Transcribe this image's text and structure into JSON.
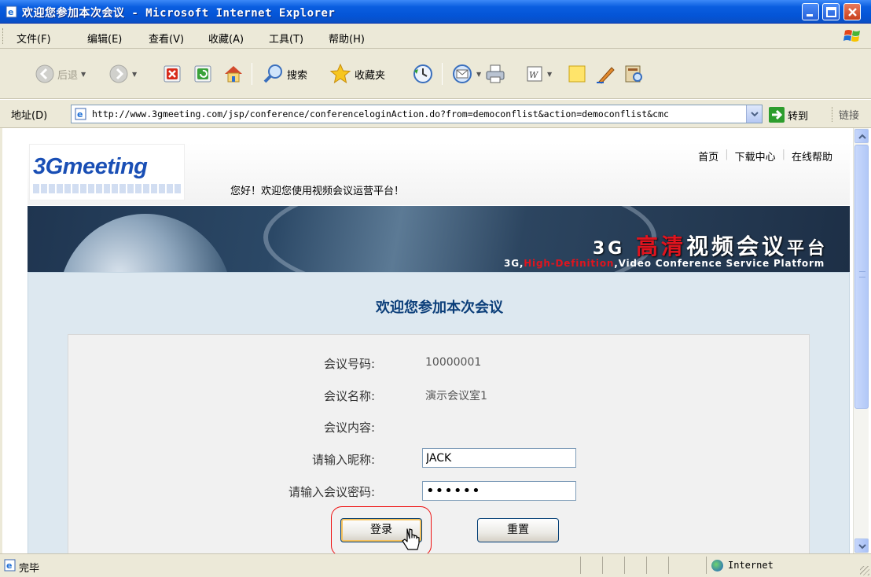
{
  "window": {
    "title": "欢迎您参加本次会议 - Microsoft Internet Explorer"
  },
  "menu": [
    "文件(F)",
    "编辑(E)",
    "查看(V)",
    "收藏(A)",
    "工具(T)",
    "帮助(H)"
  ],
  "toolbar": {
    "back": "后退",
    "search": "搜索",
    "favorites": "收藏夹"
  },
  "address": {
    "label": "地址(D)",
    "url": "http://www.3gmeeting.com/jsp/conference/conferenceloginAction.do?from=democonflist&action=democonflist&cmc",
    "go": "转到",
    "links": "链接"
  },
  "header": {
    "logo": "3Gmeeting",
    "welcome": "您好！欢迎您使用视频会议运营平台！",
    "nav": [
      "首页",
      "下载中心",
      "在线帮助"
    ]
  },
  "banner": {
    "title_prefix": "3G",
    "title_highlight": "高清",
    "title_main": "视频会议",
    "title_suffix": "平台",
    "subtitle_prefix": "3G,",
    "subtitle_highlight": "High-Definition",
    "subtitle_rest": ",Video Conference Service Platform"
  },
  "form": {
    "title": "欢迎您参加本次会议",
    "meeting_number_label": "会议号码:",
    "meeting_number": "10000001",
    "meeting_name_label": "会议名称:",
    "meeting_name": "演示会议室1",
    "meeting_content_label": "会议内容:",
    "nickname_label": "请输入昵称:",
    "nickname_value": "JACK",
    "password_label": "请输入会议密码:",
    "password_mask": "••••••",
    "login_button": "登录",
    "reset_button": "重置"
  },
  "status": {
    "text": "完毕",
    "zone": "Internet"
  },
  "colors": {
    "title_bar": "#0454d6",
    "panel_bg": "#dde8f0",
    "panel_title": "#0c3f7a",
    "highlight": "#e11111"
  }
}
